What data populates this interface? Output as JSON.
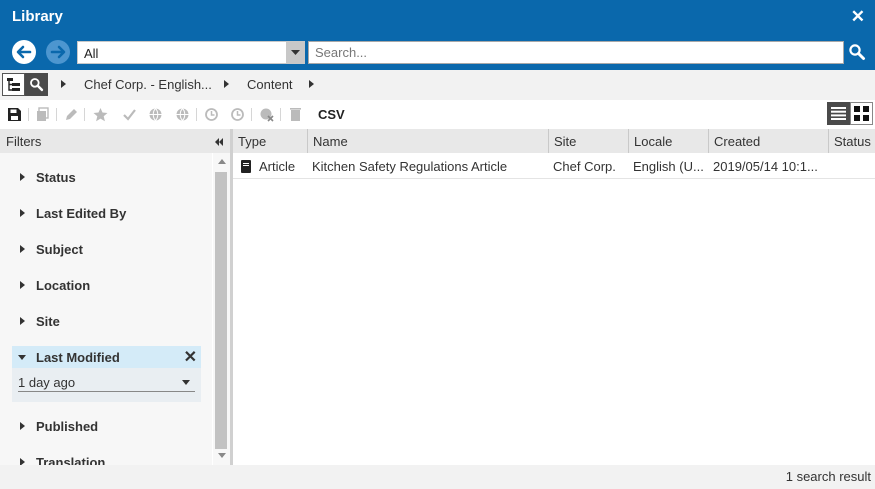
{
  "window": {
    "title": "Library"
  },
  "nav": {
    "scope_value": "All",
    "search_placeholder": "Search..."
  },
  "breadcrumb": [
    "Chef Corp. - English...",
    "Content"
  ],
  "toolbar": {
    "csv_label": "CSV"
  },
  "filters": {
    "header": "Filters",
    "items": [
      "Status",
      "Last Edited By",
      "Subject",
      "Location",
      "Site"
    ],
    "expanded": {
      "label": "Last Modified",
      "value": "1 day ago"
    },
    "items_after": [
      "Published",
      "Translation"
    ]
  },
  "table": {
    "columns": [
      "Type",
      "Name",
      "Site",
      "Locale",
      "Created",
      "Status"
    ],
    "rows": [
      {
        "type": "Article",
        "name": "Kitchen Safety Regulations Article",
        "site": "Chef Corp.",
        "locale": "English (U...",
        "created": "2019/05/14 10:1...",
        "status": ""
      }
    ]
  },
  "status": {
    "result_text": "1 search result"
  },
  "colors": {
    "titlebar": "#0a68ac",
    "accent_selected": "#d4ebf8"
  }
}
